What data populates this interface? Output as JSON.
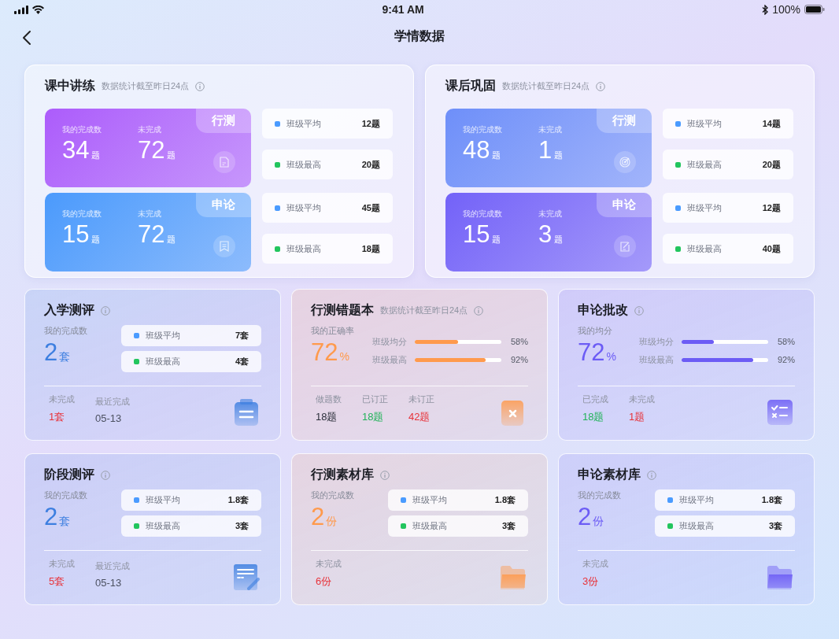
{
  "status_bar": {
    "time": "9:41 AM",
    "battery": "100%"
  },
  "header": {
    "title": "学情数据"
  },
  "panels": [
    {
      "title": "课中讲练",
      "note": "数据统计截至昨日24点",
      "blocks": [
        {
          "tag": "行测",
          "color": "#ac5cfb",
          "done_label": "我的完成数",
          "done_value": "34",
          "done_unit": "题",
          "todo_label": "未完成",
          "todo_value": "72",
          "todo_unit": "题",
          "stats": [
            {
              "label": "班级平均",
              "value": "12题",
              "color": "#4a9bff"
            },
            {
              "label": "班级最高",
              "value": "20题",
              "color": "#22c55e"
            }
          ]
        },
        {
          "tag": "申论",
          "color": "#4b9afc",
          "done_label": "我的完成数",
          "done_value": "15",
          "done_unit": "题",
          "todo_label": "未完成",
          "todo_value": "72",
          "todo_unit": "题",
          "stats": [
            {
              "label": "班级平均",
              "value": "45题",
              "color": "#4a9bff"
            },
            {
              "label": "班级最高",
              "value": "18题",
              "color": "#22c55e"
            }
          ]
        }
      ]
    },
    {
      "title": "课后巩固",
      "note": "数据统计截至昨日24点",
      "blocks": [
        {
          "tag": "行测",
          "color": "#6e8ff9",
          "done_label": "我的完成数",
          "done_value": "48",
          "done_unit": "题",
          "todo_label": "未完成",
          "todo_value": "1",
          "todo_unit": "题",
          "stats": [
            {
              "label": "班级平均",
              "value": "14题",
              "color": "#4a9bff"
            },
            {
              "label": "班级最高",
              "value": "20题",
              "color": "#22c55e"
            }
          ]
        },
        {
          "tag": "申论",
          "color": "#7362f8",
          "done_label": "我的完成数",
          "done_value": "15",
          "done_unit": "题",
          "todo_label": "未完成",
          "todo_value": "3",
          "todo_unit": "题",
          "stats": [
            {
              "label": "班级平均",
              "value": "12题",
              "color": "#4a9bff"
            },
            {
              "label": "班级最高",
              "value": "40题",
              "color": "#22c55e"
            }
          ]
        }
      ]
    }
  ],
  "cards": [
    {
      "kind": "count",
      "color": "#3d7fe0",
      "title": "入学测评",
      "main": {
        "label": "我的完成数",
        "value": "2",
        "unit": "套"
      },
      "stats": [
        {
          "label": "班级平均",
          "value": "7套",
          "color": "#4a9bff"
        },
        {
          "label": "班级最高",
          "value": "4套",
          "color": "#22c55e"
        }
      ],
      "footer": [
        {
          "label": "未完成",
          "value": "1套",
          "color": "#e8333a"
        },
        {
          "label": "最近完成",
          "value": "05-13",
          "color": "#4b5060"
        }
      ]
    },
    {
      "kind": "rate",
      "color": "#ff9a4d",
      "title": "行测错题本",
      "note": "数据统计截至昨日24点",
      "main": {
        "label": "我的正确率",
        "value": "72",
        "unit": "%"
      },
      "bars": [
        {
          "label": "班级均分",
          "level": 0.5,
          "reading": "58%"
        },
        {
          "label": "班级最高",
          "level": 0.82,
          "reading": "92%"
        }
      ],
      "footer": [
        {
          "label": "做题数",
          "value": "18题",
          "color": "#2b2f3a"
        },
        {
          "label": "已订正",
          "value": "18题",
          "color": "#22b35a"
        },
        {
          "label": "未订正",
          "value": "42题",
          "color": "#e8333a"
        }
      ]
    },
    {
      "kind": "rate",
      "color": "#6c5cf5",
      "title": "申论批改",
      "main": {
        "label": "我的均分",
        "value": "72",
        "unit": "%"
      },
      "bars": [
        {
          "label": "班级均分",
          "level": 0.37,
          "reading": "58%"
        },
        {
          "label": "班级最高",
          "level": 0.83,
          "reading": "92%"
        }
      ],
      "footer": [
        {
          "label": "已完成",
          "value": "18题",
          "color": "#22b35a"
        },
        {
          "label": "未完成",
          "value": "1题",
          "color": "#e8333a"
        }
      ]
    },
    {
      "kind": "count",
      "color": "#3d7fe0",
      "title": "阶段测评",
      "main": {
        "label": "我的完成数",
        "value": "2",
        "unit": "套"
      },
      "stats": [
        {
          "label": "班级平均",
          "value": "1.8套",
          "color": "#4a9bff"
        },
        {
          "label": "班级最高",
          "value": "3套",
          "color": "#22c55e"
        }
      ],
      "footer": [
        {
          "label": "未完成",
          "value": "5套",
          "color": "#e8333a"
        },
        {
          "label": "最近完成",
          "value": "05-13",
          "color": "#4b5060"
        }
      ]
    },
    {
      "kind": "count",
      "color": "#ff9a4d",
      "title": "行测素材库",
      "main": {
        "label": "我的完成数",
        "value": "2",
        "unit": "份"
      },
      "stats": [
        {
          "label": "班级平均",
          "value": "1.8套",
          "color": "#4a9bff"
        },
        {
          "label": "班级最高",
          "value": "3套",
          "color": "#22c55e"
        }
      ],
      "footer": [
        {
          "label": "未完成",
          "value": "6份",
          "color": "#e8333a"
        }
      ]
    },
    {
      "kind": "count",
      "color": "#6c5cf5",
      "title": "申论素材库",
      "main": {
        "label": "我的完成数",
        "value": "2",
        "unit": "份"
      },
      "stats": [
        {
          "label": "班级平均",
          "value": "1.8套",
          "color": "#4a9bff"
        },
        {
          "label": "班级最高",
          "value": "3套",
          "color": "#22c55e"
        }
      ],
      "footer": [
        {
          "label": "未完成",
          "value": "3份",
          "color": "#e8333a"
        }
      ]
    }
  ]
}
